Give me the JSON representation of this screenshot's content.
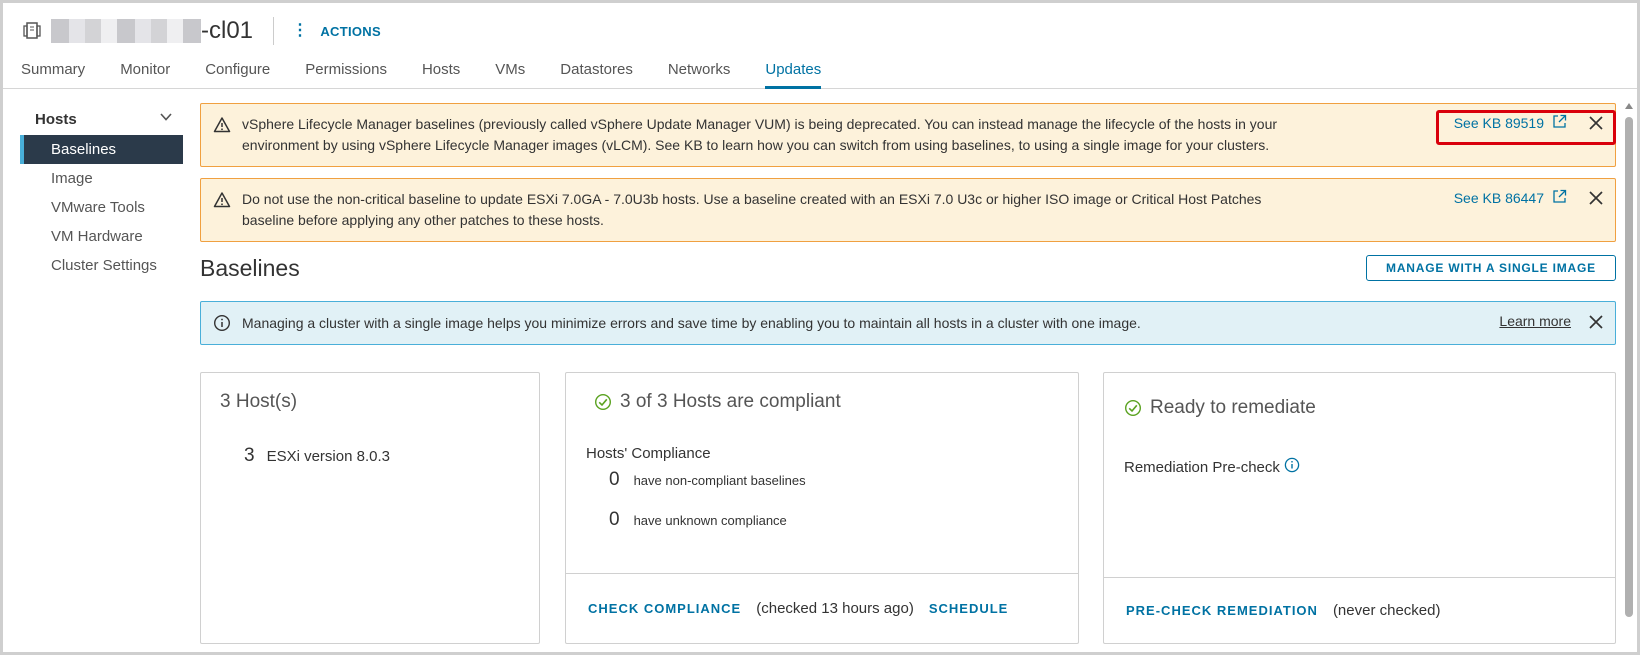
{
  "header": {
    "title_suffix": "-cl01",
    "actions_label": "ACTIONS"
  },
  "tabs": [
    {
      "label": "Summary"
    },
    {
      "label": "Monitor"
    },
    {
      "label": "Configure"
    },
    {
      "label": "Permissions"
    },
    {
      "label": "Hosts"
    },
    {
      "label": "VMs"
    },
    {
      "label": "Datastores"
    },
    {
      "label": "Networks"
    },
    {
      "label": "Updates",
      "active": true
    }
  ],
  "leftnav": {
    "group_label": "Hosts",
    "items": [
      {
        "label": "Baselines",
        "active": true
      },
      {
        "label": "Image"
      },
      {
        "label": "VMware Tools"
      },
      {
        "label": "VM Hardware"
      },
      {
        "label": "Cluster Settings"
      }
    ]
  },
  "alerts": {
    "deprecation": {
      "line1": "vSphere Lifecycle Manager baselines (previously called vSphere Update Manager VUM) is being deprecated. You can instead manage the lifecycle of the hosts in your",
      "line2": "environment by using vSphere Lifecycle Manager images (vLCM). See KB to learn how you can switch from using baselines, to using a single image for your clusters.",
      "link": "See KB 89519"
    },
    "noncritical": {
      "line1": "Do not use the non-critical baseline to update ESXi 7.0GA - 7.0U3b hosts. Use a baseline created with an ESXi 7.0 U3c or higher ISO image or Critical Host Patches",
      "line2": "baseline before applying any other patches to these hosts.",
      "link": "See KB 86447"
    },
    "info": {
      "text": "Managing a cluster with a single image helps you minimize errors and save time by enabling you to maintain all hosts in a cluster with one image.",
      "link": "Learn more"
    }
  },
  "baselines": {
    "title": "Baselines",
    "manage_button": "MANAGE WITH A SINGLE IMAGE"
  },
  "cards": {
    "hosts": {
      "title": "3 Host(s)",
      "count": "3",
      "version_label": "ESXi version 8.0.3"
    },
    "compliance": {
      "title": "3 of 3 Hosts are compliant",
      "subtitle": "Hosts' Compliance",
      "noncompliant_count": "0",
      "noncompliant_label": "have non-compliant baselines",
      "unknown_count": "0",
      "unknown_label": "have unknown compliance",
      "check_button": "CHECK COMPLIANCE",
      "checked_text": "(checked 13 hours ago)",
      "schedule_button": "SCHEDULE"
    },
    "remediate": {
      "title": "Ready to remediate",
      "precheck_label": "Remediation Pre-check",
      "precheck_button": "PRE-CHECK REMEDIATION",
      "never_text": "(never checked)"
    }
  },
  "colors": {
    "accent": "#0072a3",
    "warning_bg": "#fdf2db",
    "warning_border": "#f0a040",
    "info_bg": "#e1f1f6",
    "highlight": "#d9000b",
    "success": "#5aa220"
  },
  "icons": [
    "cluster-icon",
    "kebab-icon",
    "chevron-down-icon",
    "warning-icon",
    "external-link-icon",
    "close-icon",
    "info-icon",
    "check-circle-icon"
  ]
}
